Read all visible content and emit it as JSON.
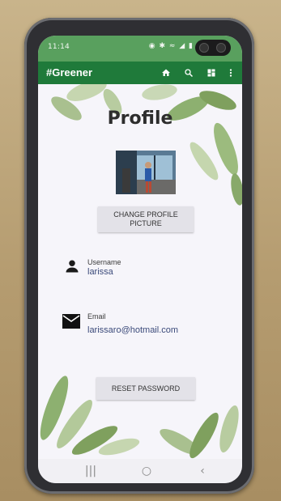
{
  "status_bar": {
    "time": "11:14",
    "icons_text": "◉ ✱ ≈ ◢ ▮"
  },
  "app_bar": {
    "title": "#Greener",
    "icons": [
      "home-icon",
      "search-icon",
      "dashboard-icon",
      "more-vert-icon"
    ]
  },
  "profile": {
    "title": "Profile",
    "change_picture_label_1": "CHANGE PROFILE",
    "change_picture_label_2": "PICTURE",
    "username_label": "Username",
    "username_value": "larissa",
    "email_label": "Email",
    "email_value": "larissaro@hotmail.com",
    "reset_password_label": "RESET PASSWORD"
  },
  "nav_bar": {
    "recents_glyph": "|||",
    "home_glyph": "○",
    "back_glyph": "‹"
  },
  "colors": {
    "status_bar": "#59a05e",
    "app_bar": "#1f7a3a",
    "leaf_dark": "#7fa05e",
    "leaf_light": "#c6d6b0"
  }
}
